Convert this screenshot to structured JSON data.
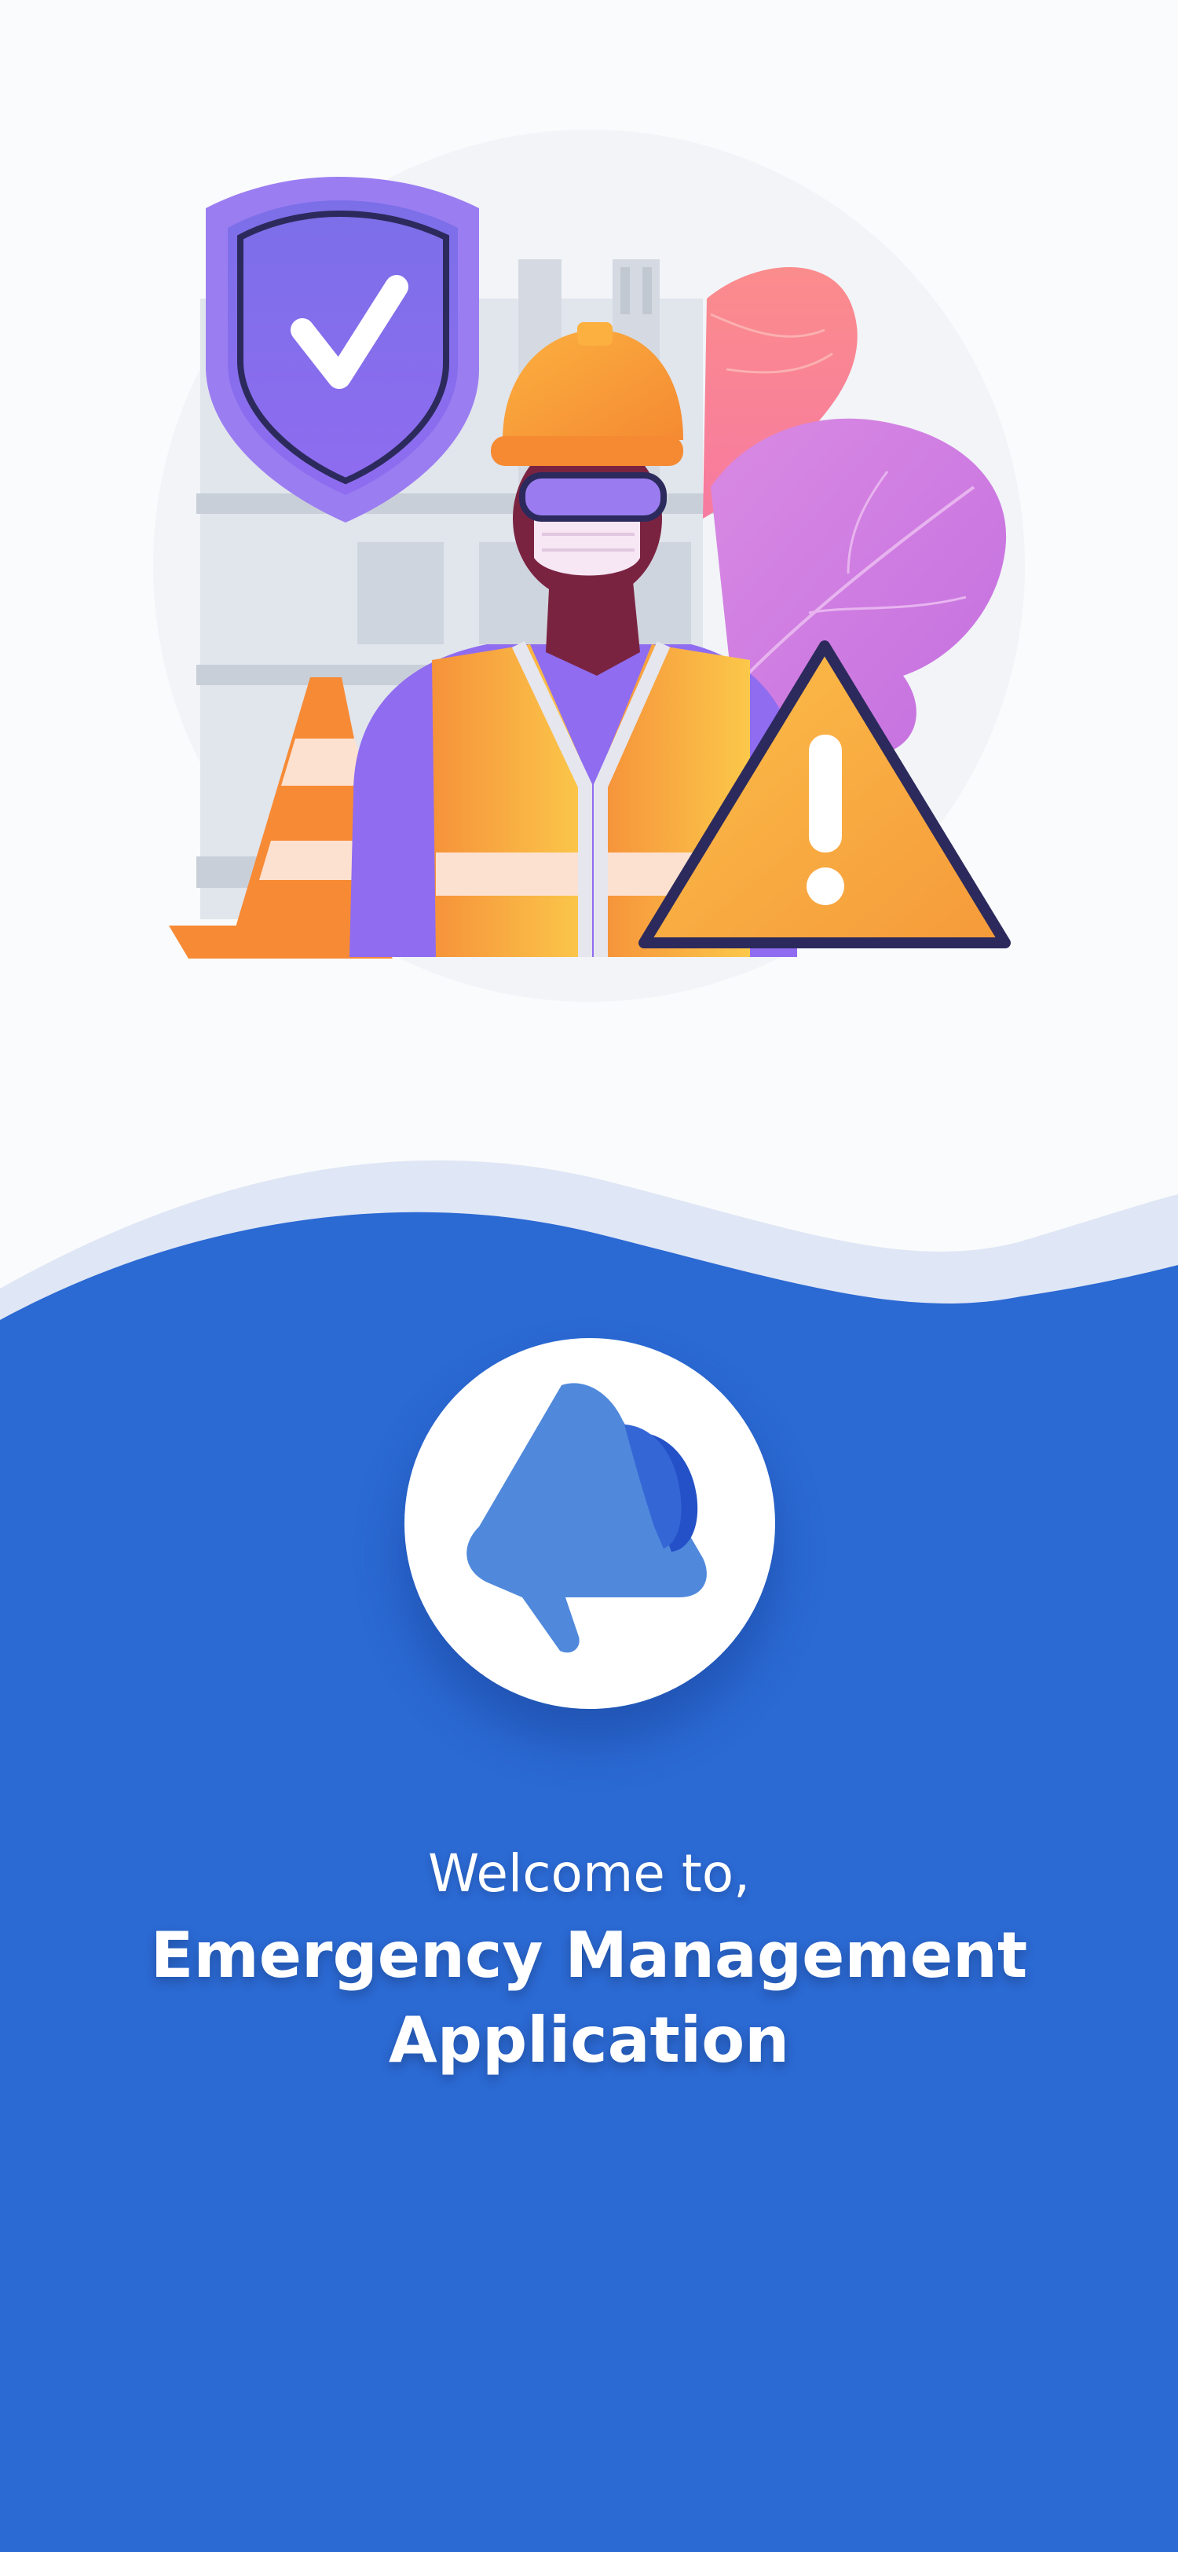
{
  "welcome": {
    "greeting": "Welcome to,",
    "title_line1": "Emergency Management",
    "title_line2": "Application"
  },
  "colors": {
    "background_top": "#fafbfc",
    "wave_light": "#dfe6f5",
    "brand_blue": "#2b69d3",
    "logo_circle": "#ffffff",
    "logo_icon": "#5089dc",
    "logo_icon_dark": "#2451c7"
  },
  "icons": {
    "hero": "safety-worker-illustration",
    "shield": "shield-check-icon",
    "warning": "warning-triangle-icon",
    "cone": "traffic-cone-icon",
    "logo": "megaphone-icon"
  }
}
